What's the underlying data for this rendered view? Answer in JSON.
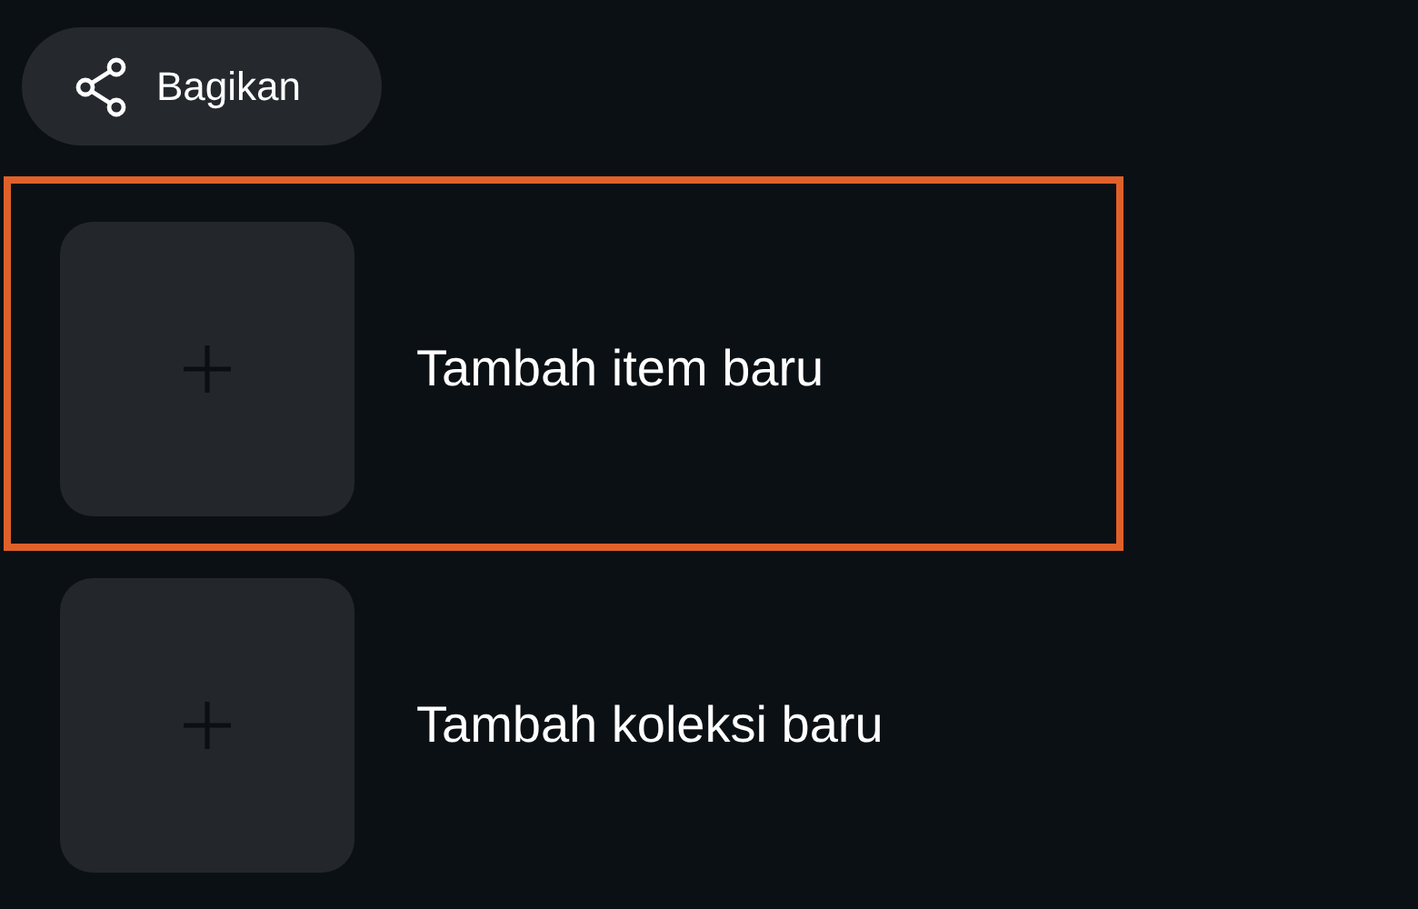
{
  "share_button": {
    "label": "Bagikan"
  },
  "items": [
    {
      "label": "Tambah item baru",
      "selected": true
    },
    {
      "label": "Tambah koleksi baru",
      "selected": false
    }
  ]
}
